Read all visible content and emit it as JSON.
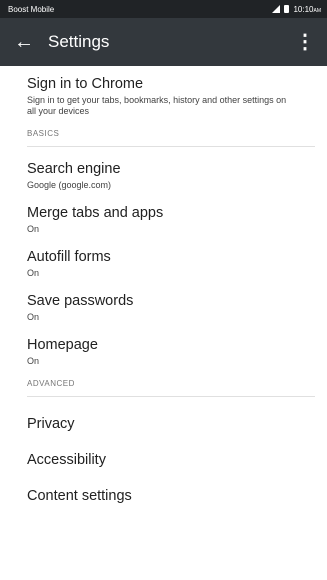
{
  "status_bar": {
    "carrier": "Boost Mobile",
    "time": "10:10",
    "ampm": "AM"
  },
  "toolbar": {
    "title": "Settings"
  },
  "signin": {
    "title": "Sign in to Chrome",
    "subtitle": "Sign in to get your tabs, bookmarks, history and other settings on all your devices"
  },
  "sections": {
    "basics": "BASICS",
    "advanced": "ADVANCED"
  },
  "basics": [
    {
      "title": "Search engine",
      "subtitle": "Google (google.com)"
    },
    {
      "title": "Merge tabs and apps",
      "subtitle": "On"
    },
    {
      "title": "Autofill forms",
      "subtitle": "On"
    },
    {
      "title": "Save passwords",
      "subtitle": "On"
    },
    {
      "title": "Homepage",
      "subtitle": "On"
    }
  ],
  "advanced": [
    {
      "title": "Privacy"
    },
    {
      "title": "Accessibility"
    },
    {
      "title": "Content settings"
    }
  ]
}
